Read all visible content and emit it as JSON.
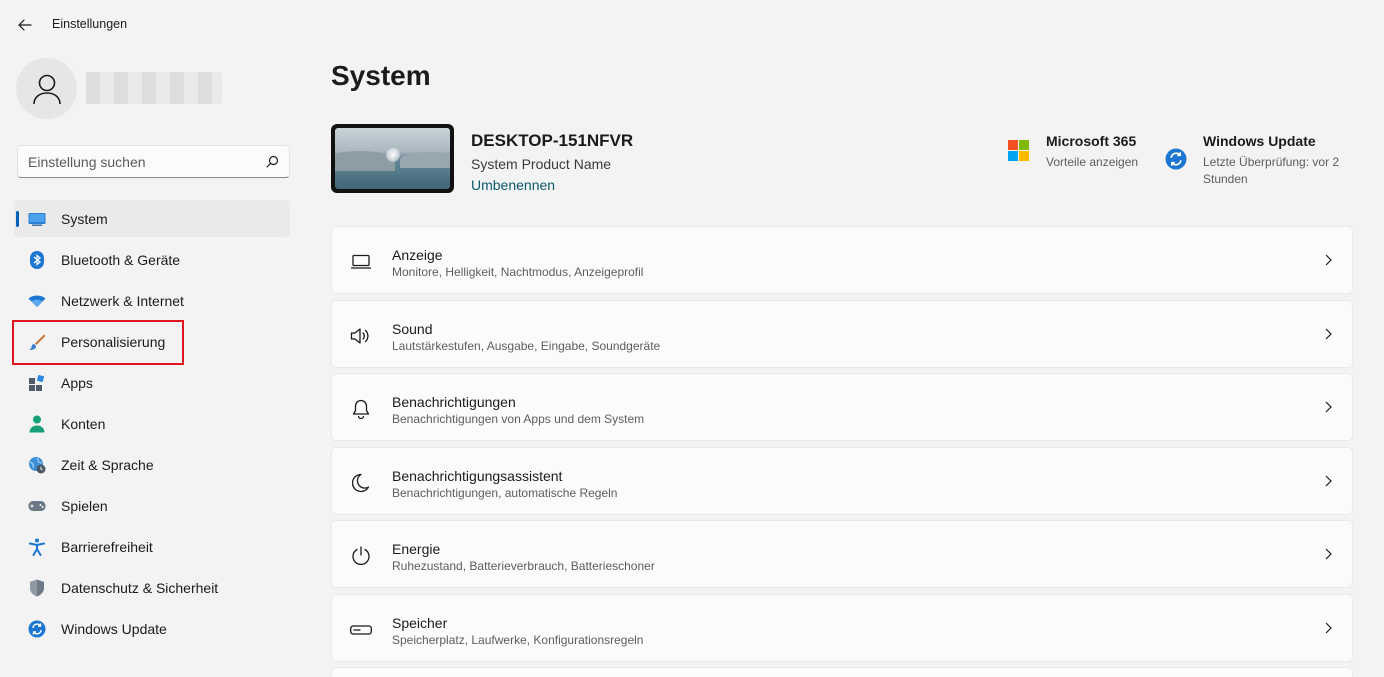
{
  "window": {
    "title": "Einstellungen"
  },
  "sidebar": {
    "search_placeholder": "Einstellung suchen",
    "items": [
      {
        "label": "System",
        "icon": "monitor-icon",
        "active": true
      },
      {
        "label": "Bluetooth & Geräte",
        "icon": "bluetooth-icon"
      },
      {
        "label": "Netzwerk & Internet",
        "icon": "wifi-icon"
      },
      {
        "label": "Personalisierung",
        "icon": "brush-icon",
        "highlighted": true
      },
      {
        "label": "Apps",
        "icon": "apps-icon"
      },
      {
        "label": "Konten",
        "icon": "person-icon"
      },
      {
        "label": "Zeit & Sprache",
        "icon": "globe-clock-icon"
      },
      {
        "label": "Spielen",
        "icon": "gamepad-icon"
      },
      {
        "label": "Barrierefreiheit",
        "icon": "accessibility-icon"
      },
      {
        "label": "Datenschutz & Sicherheit",
        "icon": "shield-icon"
      },
      {
        "label": "Windows Update",
        "icon": "update-icon"
      }
    ]
  },
  "main": {
    "title": "System",
    "device": {
      "name": "DESKTOP-151NFVR",
      "model": "System Product Name",
      "rename_label": "Umbenennen"
    },
    "tiles": [
      {
        "title": "Microsoft 365",
        "subtitle": "Vorteile anzeigen",
        "icon": "microsoft-logo-icon"
      },
      {
        "title": "Windows Update",
        "subtitle": "Letzte Überprüfung: vor 2 Stunden",
        "icon": "update-icon"
      }
    ],
    "cards": [
      {
        "title": "Anzeige",
        "subtitle": "Monitore, Helligkeit, Nachtmodus, Anzeigeprofil",
        "icon": "display-icon"
      },
      {
        "title": "Sound",
        "subtitle": "Lautstärkestufen, Ausgabe, Eingabe, Soundgeräte",
        "icon": "speaker-icon"
      },
      {
        "title": "Benachrichtigungen",
        "subtitle": "Benachrichtigungen von Apps und dem System",
        "icon": "bell-icon"
      },
      {
        "title": "Benachrichtigungsassistent",
        "subtitle": "Benachrichtigungen, automatische Regeln",
        "icon": "moon-icon"
      },
      {
        "title": "Energie",
        "subtitle": "Ruhezustand, Batterieverbrauch, Batterieschoner",
        "icon": "power-icon"
      },
      {
        "title": "Speicher",
        "subtitle": "Speicherplatz, Laufwerke, Konfigurationsregeln",
        "icon": "storage-icon"
      }
    ]
  },
  "colors": {
    "accent": "#005fb8",
    "link": "#0b5a6b",
    "highlight_box": "#e0141e",
    "background": "#f3f3f3",
    "card": "#fbfbfb"
  }
}
